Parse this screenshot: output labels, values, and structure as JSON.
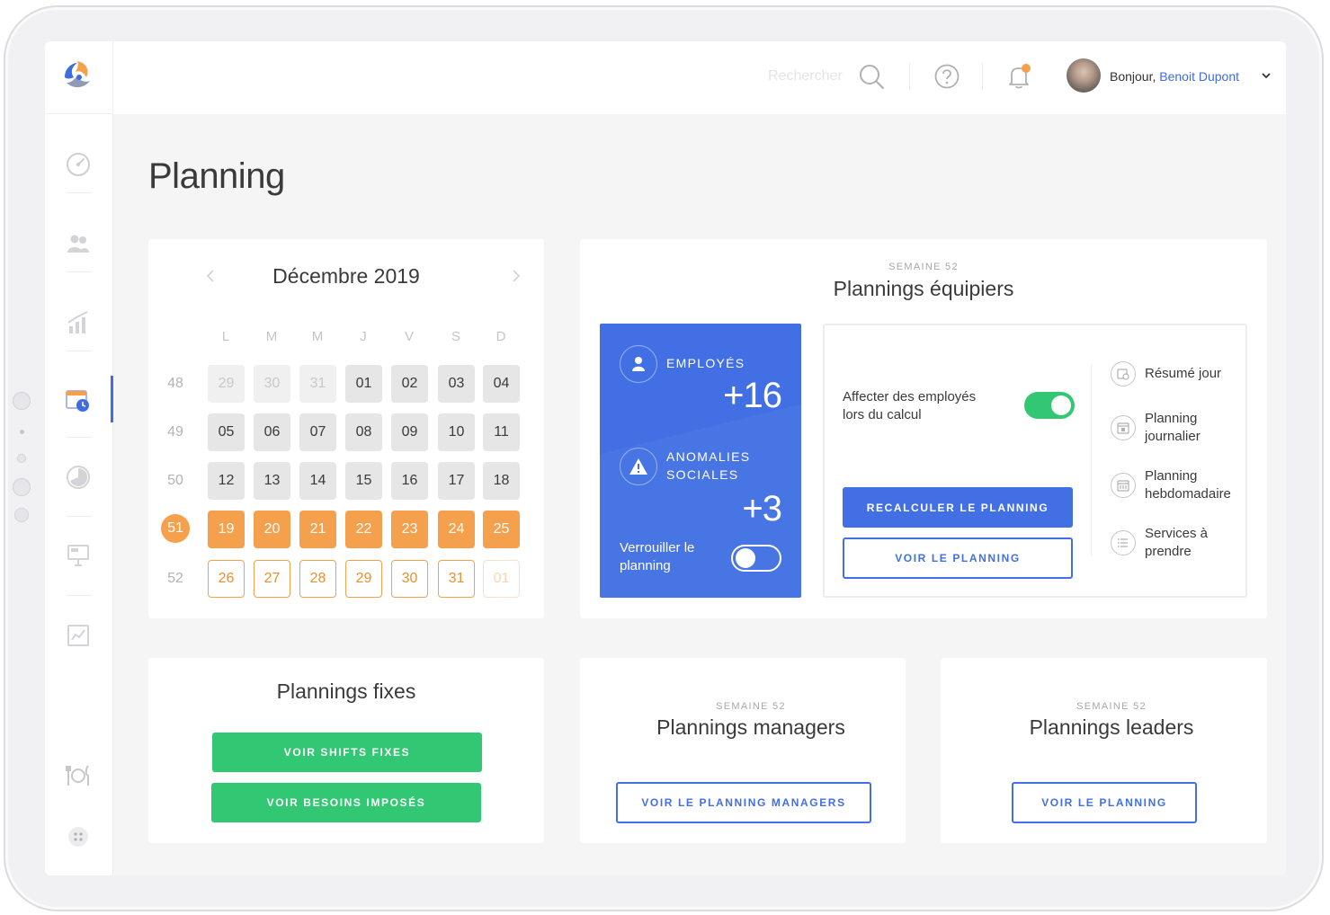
{
  "topbar": {
    "search_placeholder": "Rechercher",
    "greeting": "Bonjour,",
    "user_name": "Benoit Dupont"
  },
  "sidebar": {
    "items": [
      {
        "name": "dashboard-icon",
        "active": false
      },
      {
        "name": "users-icon",
        "active": false
      },
      {
        "name": "chart-icon",
        "active": false
      },
      {
        "name": "calendar-clock-icon",
        "active": true
      },
      {
        "name": "pie-chart-icon",
        "active": false
      },
      {
        "name": "presentation-icon",
        "active": false
      },
      {
        "name": "report-icon",
        "active": false
      },
      {
        "name": "tableware-icon",
        "active": false
      },
      {
        "name": "apps-icon",
        "active": false
      }
    ]
  },
  "page": {
    "title": "Planning"
  },
  "calendar": {
    "month_label": "Décembre 2019",
    "weekdays": [
      "L",
      "M",
      "M",
      "J",
      "V",
      "S",
      "D"
    ],
    "weeks": [
      {
        "number": "48",
        "current": false,
        "days": [
          {
            "d": "29",
            "t": "prev"
          },
          {
            "d": "30",
            "t": "prev"
          },
          {
            "d": "31",
            "t": "prev"
          },
          {
            "d": "01",
            "t": "norm"
          },
          {
            "d": "02",
            "t": "norm"
          },
          {
            "d": "03",
            "t": "norm"
          },
          {
            "d": "04",
            "t": "norm"
          }
        ]
      },
      {
        "number": "49",
        "current": false,
        "days": [
          {
            "d": "05",
            "t": "norm"
          },
          {
            "d": "06",
            "t": "norm"
          },
          {
            "d": "07",
            "t": "norm"
          },
          {
            "d": "08",
            "t": "norm"
          },
          {
            "d": "09",
            "t": "norm"
          },
          {
            "d": "10",
            "t": "norm"
          },
          {
            "d": "11",
            "t": "norm"
          }
        ]
      },
      {
        "number": "50",
        "current": false,
        "days": [
          {
            "d": "12",
            "t": "norm"
          },
          {
            "d": "13",
            "t": "norm"
          },
          {
            "d": "14",
            "t": "norm"
          },
          {
            "d": "15",
            "t": "norm"
          },
          {
            "d": "16",
            "t": "norm"
          },
          {
            "d": "17",
            "t": "norm"
          },
          {
            "d": "18",
            "t": "norm"
          }
        ]
      },
      {
        "number": "51",
        "current": true,
        "days": [
          {
            "d": "19",
            "t": "sel"
          },
          {
            "d": "20",
            "t": "sel"
          },
          {
            "d": "21",
            "t": "sel"
          },
          {
            "d": "22",
            "t": "sel"
          },
          {
            "d": "23",
            "t": "sel"
          },
          {
            "d": "24",
            "t": "sel"
          },
          {
            "d": "25",
            "t": "sel"
          }
        ]
      },
      {
        "number": "52",
        "current": false,
        "days": [
          {
            "d": "26",
            "t": "next"
          },
          {
            "d": "27",
            "t": "next"
          },
          {
            "d": "28",
            "t": "next"
          },
          {
            "d": "29",
            "t": "next"
          },
          {
            "d": "30",
            "t": "next"
          },
          {
            "d": "31",
            "t": "next"
          },
          {
            "d": "01",
            "t": "faded"
          }
        ]
      }
    ]
  },
  "equipiers": {
    "week_label": "SEMAINE 52",
    "title": "Plannings équipiers",
    "employes_label": "EMPLOYÉS",
    "employes_value": "+16",
    "anomalies_label_1": "ANOMALIES",
    "anomalies_label_2": "SOCIALES",
    "anomalies_value": "+3",
    "lock_label_1": "Verrouiller le",
    "lock_label_2": "planning",
    "lock_enabled": false,
    "assign_label_1": "Affecter des employés",
    "assign_label_2": "lors du calcul",
    "assign_enabled": true,
    "recalc_button": "RECALCULER LE PLANNING",
    "view_button": "VOIR LE PLANNING",
    "links": [
      {
        "line1": "Résumé jour",
        "line2": "",
        "icon": "clock-calendar-icon"
      },
      {
        "line1": "Planning",
        "line2": "journalier",
        "icon": "day-calendar-icon"
      },
      {
        "line1": "Planning",
        "line2": "hebdomadaire",
        "icon": "week-calendar-icon"
      },
      {
        "line1": "Services à",
        "line2": "prendre",
        "icon": "list-icon"
      }
    ]
  },
  "fixes": {
    "title": "Plannings fixes",
    "shifts_button": "VOIR SHIFTS FIXES",
    "besoins_button": "VOIR BESOINS IMPOSÉS"
  },
  "managers": {
    "week_label": "SEMAINE 52",
    "title": "Plannings managers",
    "button": "VOIR LE PLANNING MANAGERS"
  },
  "leaders": {
    "week_label": "SEMAINE 52",
    "title": "Plannings leaders",
    "button": "VOIR LE PLANNING"
  },
  "colors": {
    "primary": "#4270e4",
    "accent_orange": "#f5a04d",
    "success_green": "#32c773"
  }
}
